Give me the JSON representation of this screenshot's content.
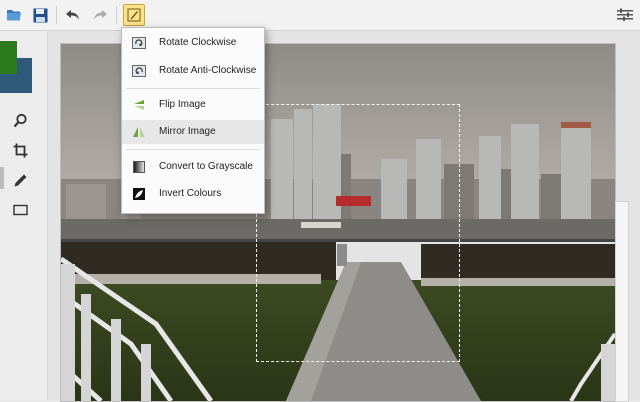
{
  "toolbar": {
    "open": {
      "icon": "folder-open-icon"
    },
    "save": {
      "icon": "save-icon"
    },
    "undo": {
      "icon": "undo-icon"
    },
    "redo": {
      "icon": "redo-icon"
    },
    "edit": {
      "icon": "edit-image-icon"
    },
    "settings": {
      "icon": "sliders-icon"
    }
  },
  "colors": {
    "primary": "#2d7a1e",
    "secondary": "#2d5a79"
  },
  "left_tools": [
    {
      "name": "zoom",
      "icon": "magnifier-icon"
    },
    {
      "name": "crop",
      "icon": "crop-icon"
    },
    {
      "name": "pencil",
      "icon": "pencil-icon"
    },
    {
      "name": "rectangle",
      "icon": "rectangle-icon"
    }
  ],
  "menu": {
    "items": [
      {
        "label": "Rotate Clockwise",
        "icon": "rotate-clockwise-icon"
      },
      {
        "label": "Rotate Anti-Clockwise",
        "icon": "rotate-anticlockwise-icon"
      },
      {
        "label": "Flip Image",
        "icon": "flip-icon"
      },
      {
        "label": "Mirror Image",
        "icon": "mirror-icon"
      },
      {
        "label": "Convert to Grayscale",
        "icon": "grayscale-icon"
      },
      {
        "label": "Invert Colours",
        "icon": "invert-icon"
      }
    ],
    "hovered": "Mirror Image"
  }
}
